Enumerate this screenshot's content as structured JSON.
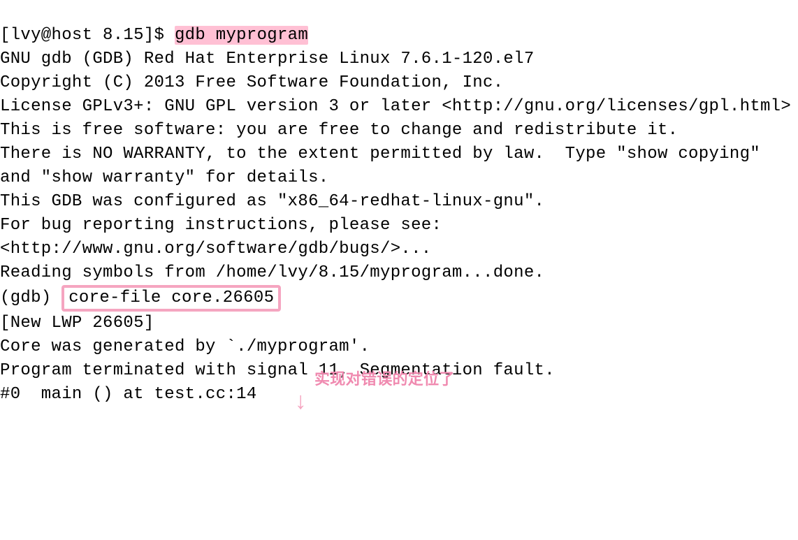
{
  "prompt_prefix": "[lvy@host 8.15]$ ",
  "command1": "gdb myprogram",
  "banner_lines": [
    "GNU gdb (GDB) Red Hat Enterprise Linux 7.6.1-120.el7",
    "Copyright (C) 2013 Free Software Foundation, Inc.",
    "License GPLv3+: GNU GPL version 3 or later <http://gnu.org/licenses/gpl.html>",
    "This is free software: you are free to change and redistribute it.",
    "There is NO WARRANTY, to the extent permitted by law.  Type \"show copying\"",
    "and \"show warranty\" for details.",
    "This GDB was configured as \"x86_64-redhat-linux-gnu\".",
    "For bug reporting instructions, please see:",
    "<http://www.gnu.org/software/gdb/bugs/>...",
    "Reading symbols from /home/lvy/8.15/myprogram...done."
  ],
  "gdb_prompt": "(gdb) ",
  "core_file_cmd": "core-file core.26605",
  "after_core_lines": [
    "[New LWP 26605]",
    "Core was generated by `./myprogram'.",
    "Program terminated with signal 11, Segmentation fault.",
    "#0  main () at test.cc:14"
  ],
  "annotation_text": "实现对错误的定位了",
  "arrow_glyph": "↓"
}
